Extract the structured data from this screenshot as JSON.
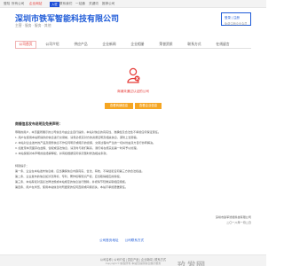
{
  "topbar": {
    "links": [
      "登陆",
      "所有公司",
      "企业网站",
      "公司网站"
    ],
    "badge": "入驻",
    "right_links": [
      "联系我们",
      "一站通",
      "关键词",
      "推荐公司"
    ]
  },
  "header": {
    "company_name": "深圳市铁军智能科技有限公司",
    "tags": "主营 · 服务 · 服务 · 其他",
    "login_line1": "登录 | 注册",
    "login_line2": "免费注册企业会员"
  },
  "nav": {
    "items": [
      "公司首页",
      "公司介绍",
      "供应产品",
      "企业新闻",
      "企业相册",
      "荣誉资质",
      "联系方式",
      "在线留言"
    ],
    "active_index": 0
  },
  "notice": {
    "text": "商铺未通过认证的公司",
    "buttons": [
      "查看商铺信息",
      "查看企业信息"
    ]
  },
  "agreement": {
    "title": "商铺信息发布说明及免责声明：",
    "paragraphs": [
      "尊敬的用户，本页面所展示的公司信息均由企业自行提供，本站对信息的真实性、准确性及合法性不承担任何保证责任。",
      "1. 用户在使用本站所提供的信息进行交易前，请务必核实对方的资质证明及相关信息，谨防上当受骗。",
      "2. 本站对企业发布的产品及服务信息不作任何明示或暗示的担保，交易过程中产生的一切纠纷由双方自行协商解决。",
      "3. 如发现本页面存在虚假、侵权或违法信息，请及时与我们联系，我们将在核实后第一时间予以处理。",
      "4. 本站保留对本声明的最终解释权，并有权根据实际情况随时修改相关条款。",
      "特别提示：",
      "第一条、企业在本站发布信息前，应当确保信息内容真实、合法、有效，不得侵犯任何第三方的合法权益。",
      "第二条、企业发布的信息如涉及商标、专利、著作权等知识产权，应当取得相应的授权。",
      "第三条、本站有权对违反法律法规或本站规定的信息进行删除，并视情节轻重采取相应措施。",
      "第四条、用户在浏览、使用本站信息时所遭受的任何直接或间接损失，本站不承担赔偿责任。"
    ],
    "signature": "深圳市铁军智能科技有限公司",
    "date": "二〇一八年一月二日"
  },
  "bottom_links": [
    "公司首页地址",
    "公司联系方式"
  ],
  "footer": {
    "line1": "公司名称 | 公司介绍 | 供应产品 | 企业新闻 | 联系方式",
    "line2": "Copyright © 版权所有 本站仅提供信息展示服务"
  },
  "watermark": "玖发网"
}
